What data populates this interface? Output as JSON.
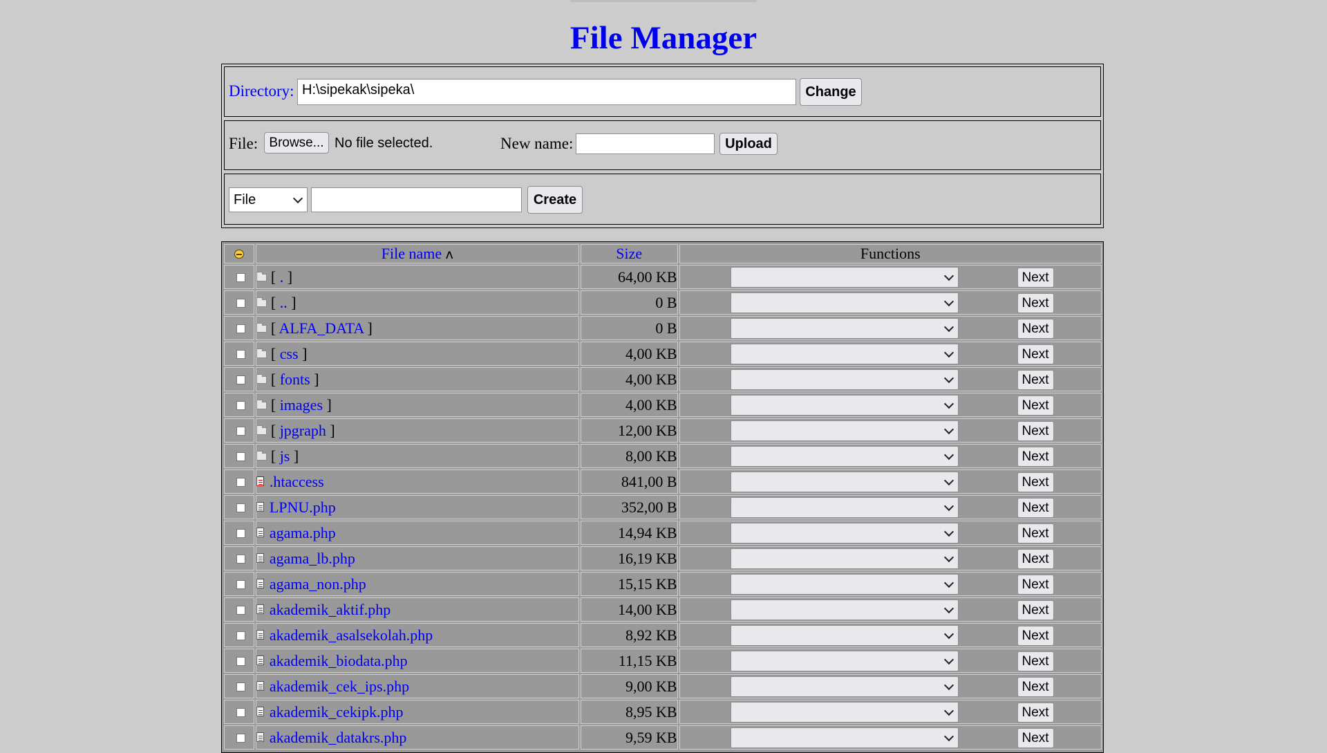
{
  "title": "File Manager",
  "directory": {
    "label": "Directory:",
    "value": "H:\\sipekak\\sipeka\\",
    "button": "Change"
  },
  "upload": {
    "file_label": "File:",
    "browse_button": "Browse...",
    "no_file_text": "No file selected.",
    "new_name_label": "New name:",
    "new_name_value": "",
    "button": "Upload"
  },
  "create": {
    "type_selected": "File",
    "name_value": "",
    "button": "Create"
  },
  "table": {
    "headers": {
      "name": "File name",
      "sort_indicator": "ʌ",
      "size": "Size",
      "functions": "Functions"
    },
    "next_label": "Next",
    "rows": [
      {
        "name": ".",
        "size": "64,00 KB",
        "kind": "folder"
      },
      {
        "name": "..",
        "size": "0 B",
        "kind": "folder"
      },
      {
        "name": "ALFA_DATA",
        "size": "0 B",
        "kind": "folder"
      },
      {
        "name": "css",
        "size": "4,00 KB",
        "kind": "folder"
      },
      {
        "name": "fonts",
        "size": "4,00 KB",
        "kind": "folder"
      },
      {
        "name": "images",
        "size": "4,00 KB",
        "kind": "folder"
      },
      {
        "name": "jpgraph",
        "size": "12,00 KB",
        "kind": "folder"
      },
      {
        "name": "js",
        "size": "8,00 KB",
        "kind": "folder"
      },
      {
        "name": ".htaccess",
        "size": "841,00 B",
        "kind": "special"
      },
      {
        "name": "LPNU.php",
        "size": "352,00 B",
        "kind": "file"
      },
      {
        "name": "agama.php",
        "size": "14,94 KB",
        "kind": "file"
      },
      {
        "name": "agama_lb.php",
        "size": "16,19 KB",
        "kind": "file"
      },
      {
        "name": "agama_non.php",
        "size": "15,15 KB",
        "kind": "file"
      },
      {
        "name": "akademik_aktif.php",
        "size": "14,00 KB",
        "kind": "file"
      },
      {
        "name": "akademik_asalsekolah.php",
        "size": "8,92 KB",
        "kind": "file"
      },
      {
        "name": "akademik_biodata.php",
        "size": "11,15 KB",
        "kind": "file"
      },
      {
        "name": "akademik_cek_ips.php",
        "size": "9,00 KB",
        "kind": "file"
      },
      {
        "name": "akademik_cekipk.php",
        "size": "8,95 KB",
        "kind": "file"
      },
      {
        "name": "akademik_datakrs.php",
        "size": "9,59 KB",
        "kind": "file"
      }
    ]
  }
}
